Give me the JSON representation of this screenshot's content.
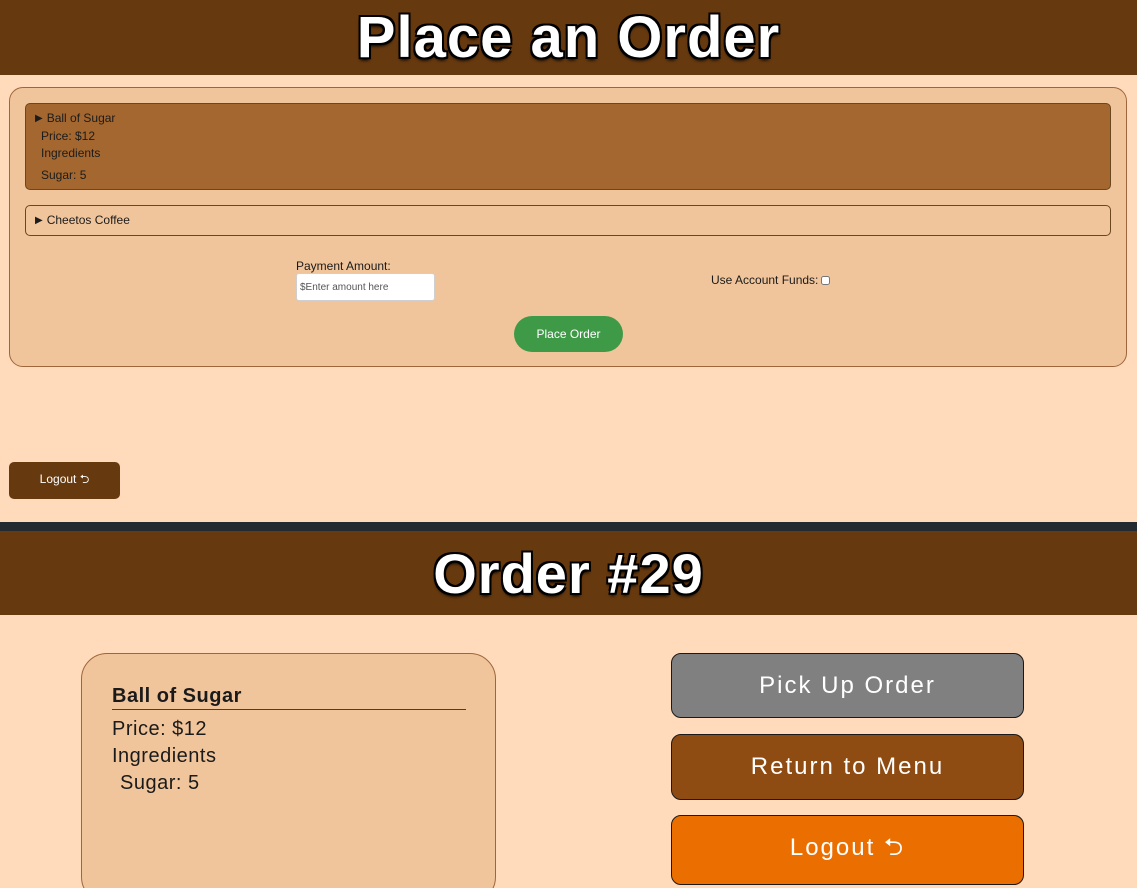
{
  "top": {
    "title": "Place an Order",
    "items": [
      {
        "name": "Ball of Sugar",
        "price": "Price: $12",
        "ingredients_label": "Ingredients",
        "ingredient": "Sugar: 5"
      },
      {
        "name": "Cheetos Coffee"
      }
    ],
    "payment_label": "Payment Amount:",
    "payment_placeholder": "$Enter amount here",
    "funds_label": "Use Account Funds:",
    "place_order_label": "Place Order",
    "logout_label": "Logout ⮌"
  },
  "bottom": {
    "title": "Order #29",
    "card": {
      "name": "Ball of Sugar",
      "price": "Price: $12",
      "ingredients_label": "Ingredients",
      "ingredient": "Sugar: 5"
    },
    "pickup_label": "Pick Up Order",
    "return_label": "Return to Menu",
    "logout_label": "Logout ⮌"
  },
  "icons": {
    "expand": "triangle-right-icon",
    "logout": "undo-arrow-icon"
  },
  "colors": {
    "header_bg": "#67390f",
    "page_bg": "#ffdbbb",
    "panel_bg": "#f1c59b",
    "open_item_bg": "#a3672f",
    "place_order_bg": "#3f9a48",
    "pickup_bg": "#808080",
    "return_bg": "#8e4b12",
    "logout_bg": "#eb6f00"
  }
}
